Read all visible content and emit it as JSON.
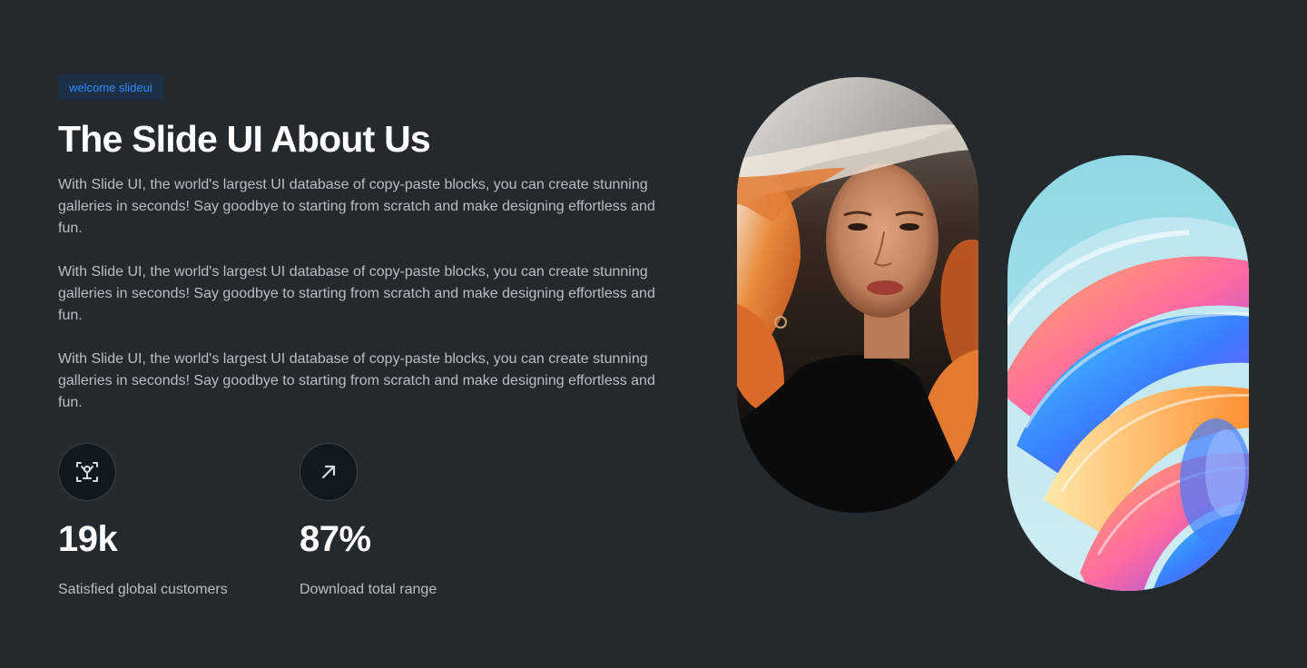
{
  "badge": {
    "label": "welcome slideui"
  },
  "heading": {
    "title": "The Slide UI About Us"
  },
  "paragraphs": [
    "With Slide UI, the world's largest UI database of copy-paste blocks, you can create stunning galleries in seconds! Say goodbye to starting from scratch and make designing effortless and fun.",
    "With Slide UI, the world's largest UI database of copy-paste blocks, you can create stunning galleries in seconds! Say goodbye to starting from scratch and make designing effortless and fun.",
    "With Slide UI, the world's largest UI database of copy-paste blocks, you can create stunning galleries in seconds! Say goodbye to starting from scratch and make designing effortless and fun."
  ],
  "stats": [
    {
      "icon": "user-scan-icon",
      "value": "19k",
      "label": "Satisfied global customers"
    },
    {
      "icon": "arrow-up-right-icon",
      "value": "87%",
      "label": "Download total range"
    }
  ],
  "images": [
    {
      "name": "portrait-image"
    },
    {
      "name": "abstract-swirl-image"
    }
  ],
  "colors": {
    "background": "#24292e",
    "badge_bg": "#1c2f45",
    "badge_text": "#2d8cff",
    "heading": "#ffffff",
    "body_text": "#b8bec6",
    "icon_bg": "#101820"
  }
}
